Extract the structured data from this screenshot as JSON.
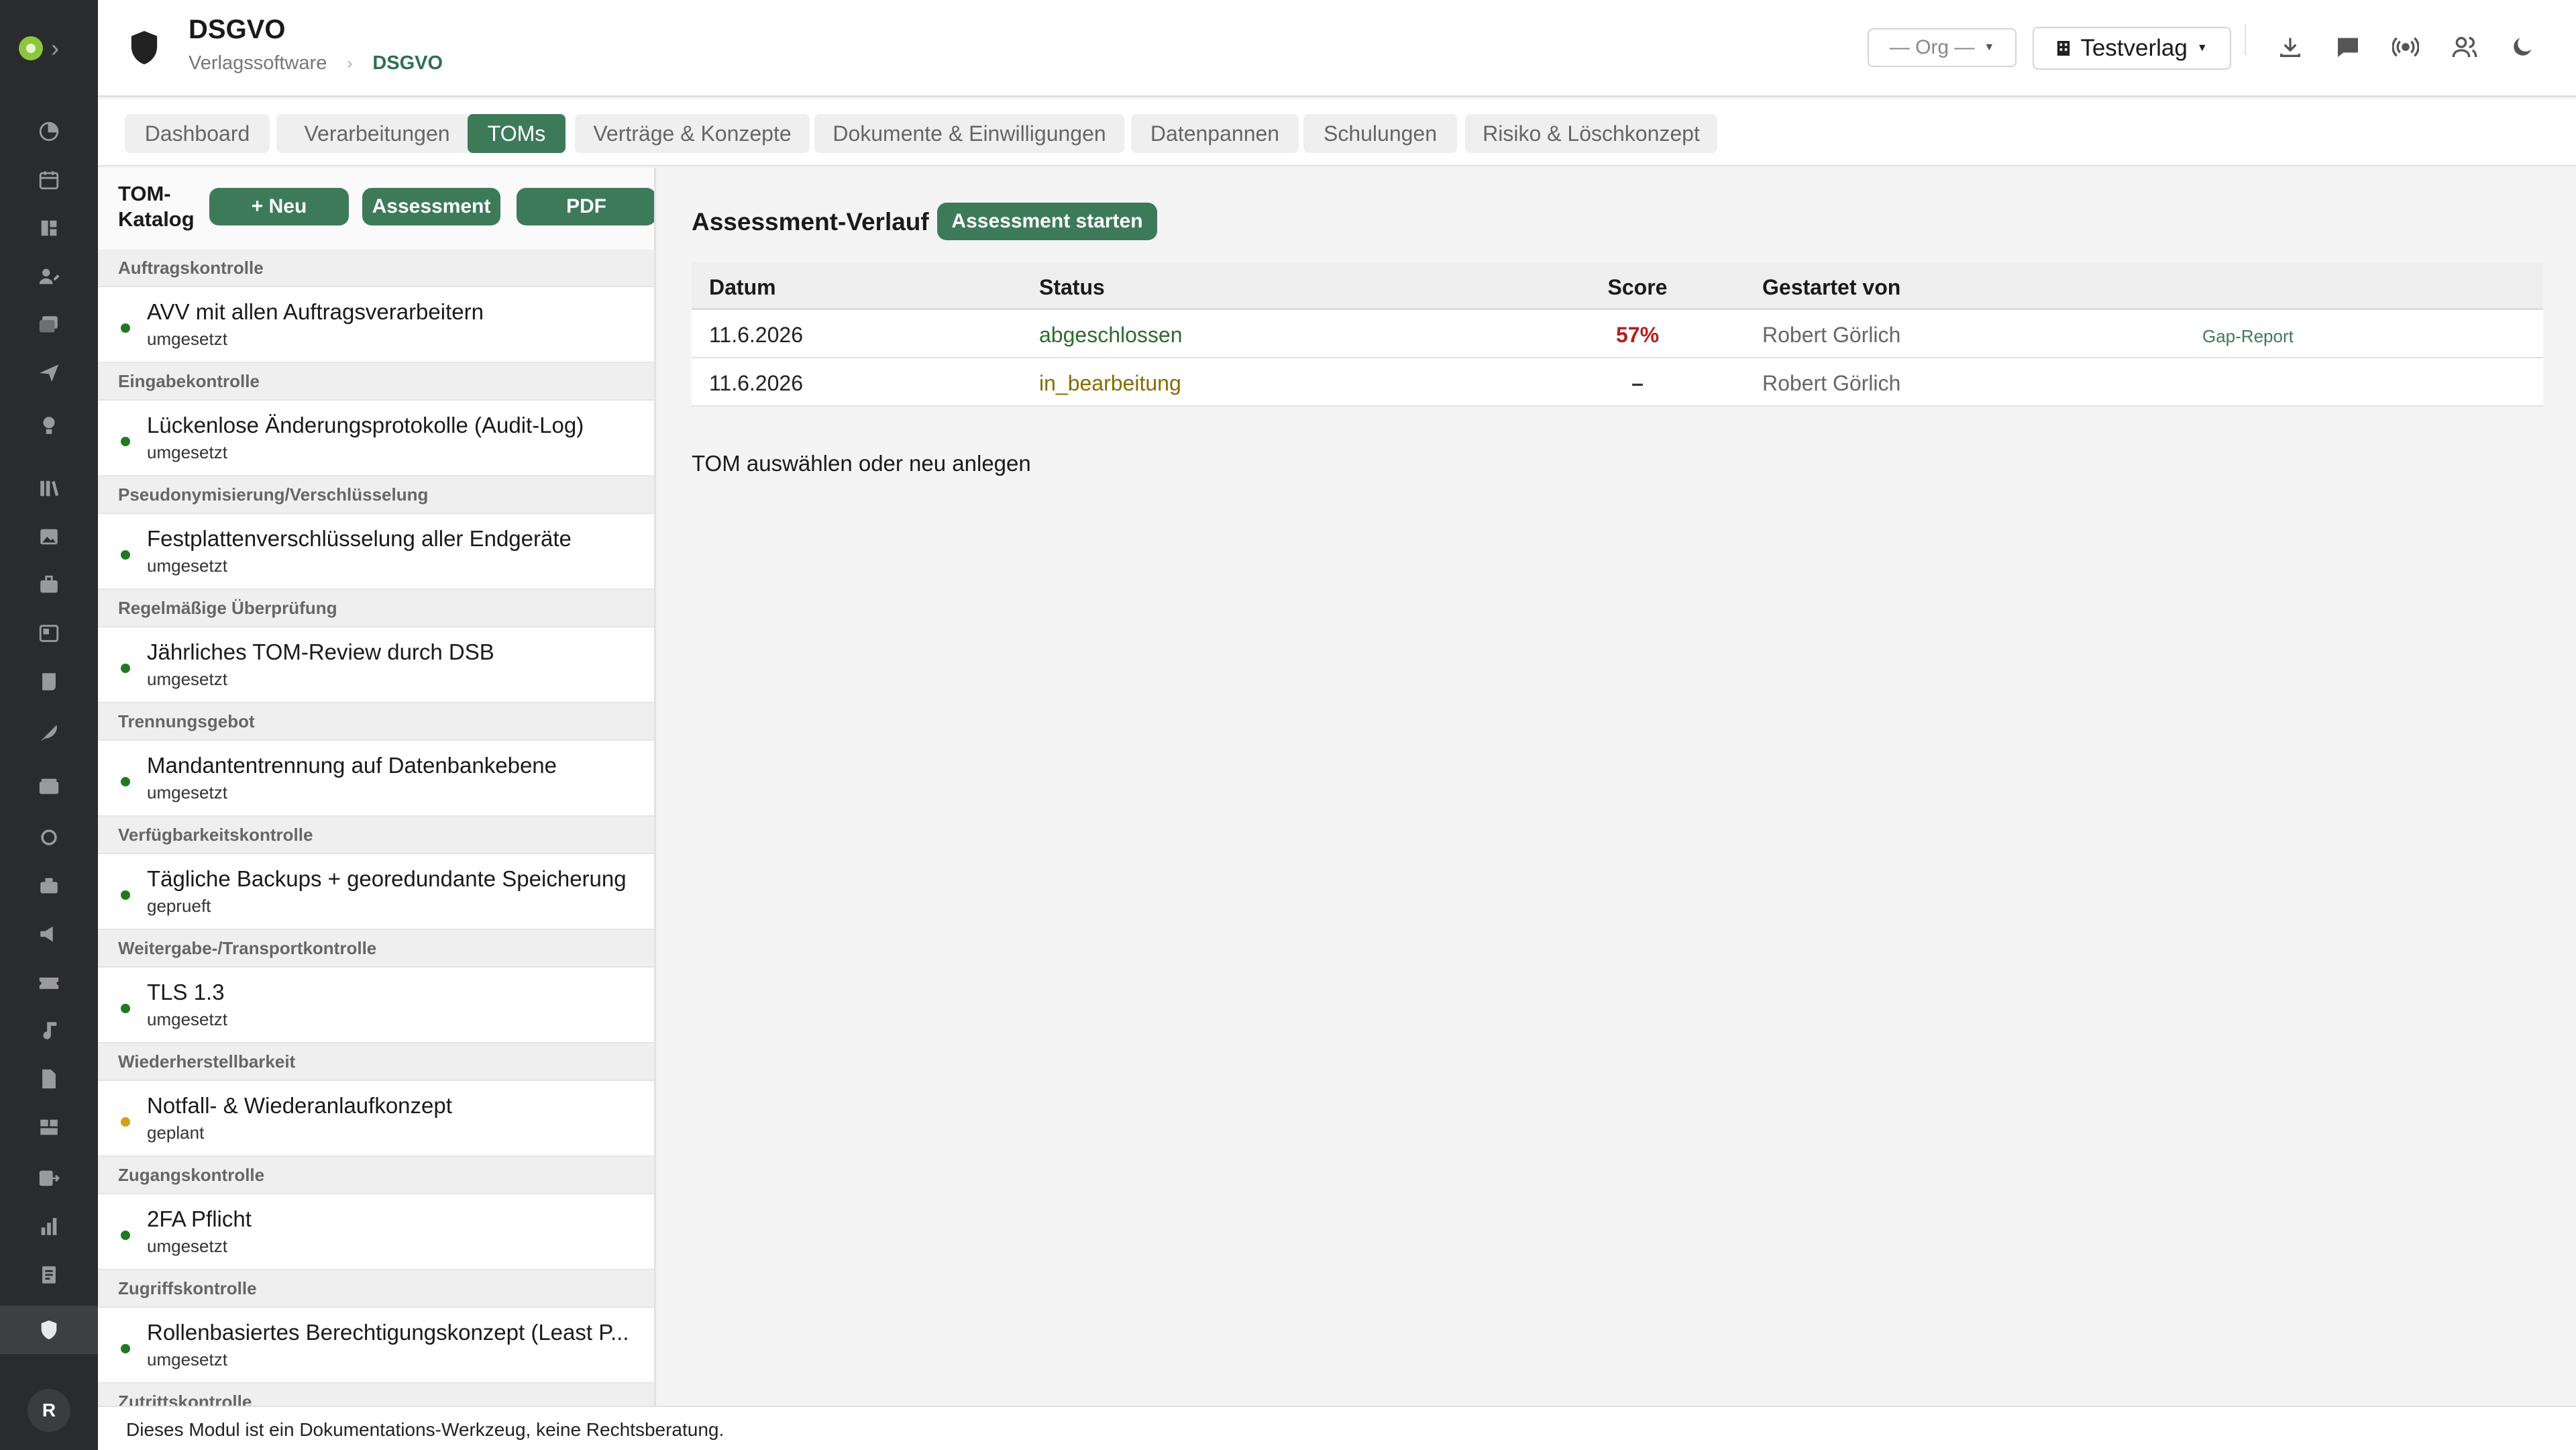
{
  "module": {
    "title": "DSGVO",
    "breadcrumb": [
      "Verlagssoftware",
      "DSGVO"
    ]
  },
  "header": {
    "org_select": "— Org —",
    "tenant_select": "Testverlag",
    "icons": [
      "download-icon",
      "chat-icon",
      "broadcast-icon",
      "users-icon",
      "dark-mode-icon"
    ]
  },
  "rail": {
    "avatar_initial": "R",
    "icons": [
      "dashboard-icon",
      "calendar-icon",
      "grid-icon",
      "user-edit-icon",
      "inbox-icon",
      "send-icon",
      "lightbulb-icon",
      "library-icon",
      "image-icon",
      "briefcase-icon",
      "board-icon",
      "scroll-icon",
      "feather-icon",
      "wallet-icon",
      "circle-icon",
      "case-icon",
      "megaphone-icon",
      "ticket-icon",
      "music-icon",
      "file-icon",
      "warehouse-icon",
      "export-icon",
      "bar-chart-icon",
      "receipt-icon",
      "shield-icon"
    ]
  },
  "tabs": [
    {
      "label": "Dashboard",
      "active": false
    },
    {
      "label": "Verarbeitungen",
      "active": false
    },
    {
      "label": "TOMs",
      "active": true
    },
    {
      "label": "Verträge & Konzepte",
      "active": false
    },
    {
      "label": "Dokumente & Einwilligungen",
      "active": false
    },
    {
      "label": "Datenpannen",
      "active": false
    },
    {
      "label": "Schulungen",
      "active": false
    },
    {
      "label": "Risiko & Löschkonzept",
      "active": false
    }
  ],
  "catalog": {
    "title_line1": "TOM-",
    "title_line2": "Katalog",
    "new_label": "+ Neu",
    "assessment_label": "Assessment",
    "pdf_label": "PDF",
    "groups": [
      {
        "name": "Auftragskontrolle",
        "items": [
          {
            "name": "AVV mit allen Auftragsverarbeitern",
            "status": "umgesetzt",
            "dot": "#1f7a1f"
          }
        ]
      },
      {
        "name": "Eingabekontrolle",
        "items": [
          {
            "name": "Lückenlose Änderungsprotokolle (Audit-Log)",
            "status": "umgesetzt",
            "dot": "#1f7a1f"
          }
        ]
      },
      {
        "name": "Pseudonymisierung/Verschlüsselung",
        "items": [
          {
            "name": "Festplattenverschlüsselung aller Endgeräte",
            "status": "umgesetzt",
            "dot": "#1f7a1f"
          }
        ]
      },
      {
        "name": "Regelmäßige Überprüfung",
        "items": [
          {
            "name": "Jährliches TOM-Review durch DSB",
            "status": "umgesetzt",
            "dot": "#1f7a1f"
          }
        ]
      },
      {
        "name": "Trennungsgebot",
        "items": [
          {
            "name": "Mandantentrennung auf Datenbankebene",
            "status": "umgesetzt",
            "dot": "#1f7a1f"
          }
        ]
      },
      {
        "name": "Verfügbarkeitskontrolle",
        "items": [
          {
            "name": "Tägliche Backups + georedundante Speicherung",
            "status": "geprueft",
            "dot": "#1f7a1f"
          }
        ]
      },
      {
        "name": "Weitergabe-/Transportkontrolle",
        "items": [
          {
            "name": "TLS 1.3",
            "status": "umgesetzt",
            "dot": "#1f7a1f"
          }
        ]
      },
      {
        "name": "Wiederherstellbarkeit",
        "items": [
          {
            "name": "Notfall- & Wiederanlaufkonzept",
            "status": "geplant",
            "dot": "#d4a017"
          }
        ]
      },
      {
        "name": "Zugangskontrolle",
        "items": [
          {
            "name": "2FA Pflicht",
            "status": "umgesetzt",
            "dot": "#1f7a1f"
          }
        ]
      },
      {
        "name": "Zugriffskontrolle",
        "items": [
          {
            "name": "Rollenbasiertes Berechtigungskonzept (Least P...",
            "status": "umgesetzt",
            "dot": "#1f7a1f"
          }
        ]
      },
      {
        "name": "Zutrittskontrolle",
        "items": []
      }
    ]
  },
  "assessment": {
    "title": "Assessment-Verlauf",
    "start_label": "Assessment starten",
    "columns": [
      "Datum",
      "Status",
      "Score",
      "Gestartet von"
    ],
    "rows": [
      {
        "date": "11.6.2026",
        "status": "abgeschlossen",
        "status_color": "#2e6b2e",
        "score": "57%",
        "score_color": "#b42020",
        "user": "Robert Görlich",
        "link": "Gap-Report"
      },
      {
        "date": "11.6.2026",
        "status": "in_bearbeitung",
        "status_color": "#8a6a00",
        "score": "–",
        "score_color": "#333333",
        "user": "Robert Görlich",
        "link": ""
      }
    ],
    "empty_hint": "TOM auswählen oder neu anlegen"
  },
  "footer": {
    "disclaimer": "Dieses Modul ist ein Dokumentations-Werkzeug, keine Rechtsberatung."
  },
  "colors": {
    "accent": "#3d7a5a",
    "rail": "#2a2b2d"
  }
}
